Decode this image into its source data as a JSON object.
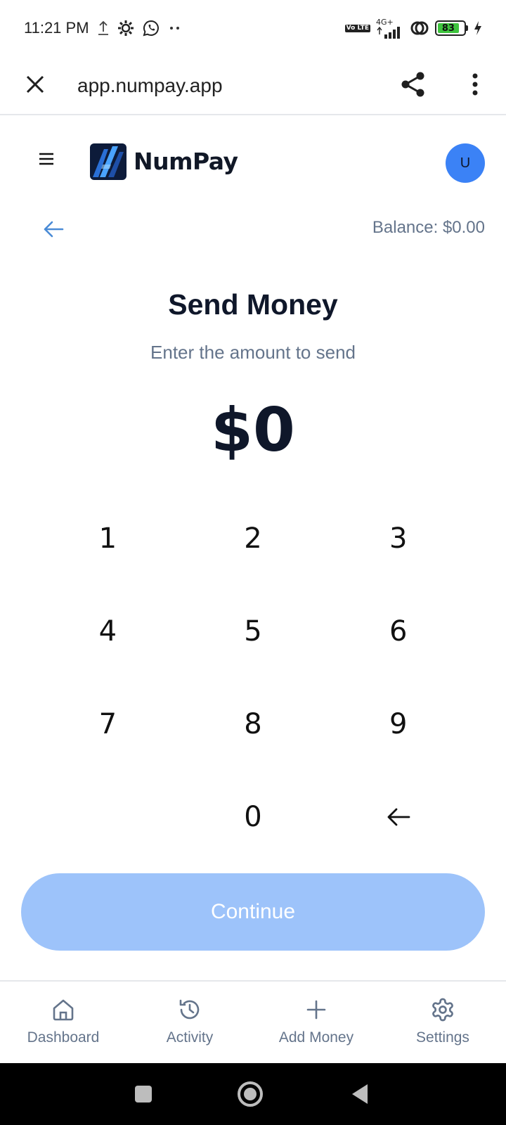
{
  "status_bar": {
    "time": "11:21 PM",
    "left_icons": [
      "upload-icon",
      "gear-icon",
      "whatsapp-icon",
      "more-dots-icon"
    ],
    "network": "4G+",
    "volte": "Vo LTE",
    "battery_level": "83",
    "right_icons": [
      "volte-icon",
      "signal-icon",
      "hotspot-icon",
      "battery-icon",
      "charging-icon"
    ]
  },
  "browser": {
    "url": "app.numpay.app",
    "icons": [
      "close-icon",
      "share-icon",
      "more-vertical-icon"
    ]
  },
  "header": {
    "brand": "NumPay",
    "avatar_initial": "U",
    "icons": [
      "menu-icon",
      "logo-icon"
    ]
  },
  "subheader": {
    "balance": "Balance: $0.00"
  },
  "main": {
    "title": "Send Money",
    "subtitle": "Enter the amount to send",
    "amount": "$0"
  },
  "keypad": {
    "keys": [
      "1",
      "2",
      "3",
      "4",
      "5",
      "6",
      "7",
      "8",
      "9",
      "",
      "0",
      "←"
    ]
  },
  "continue_label": "Continue",
  "bottom_nav": {
    "items": [
      {
        "label": "Dashboard",
        "icon": "home-icon"
      },
      {
        "label": "Activity",
        "icon": "history-icon"
      },
      {
        "label": "Add Money",
        "icon": "plus-icon"
      },
      {
        "label": "Settings",
        "icon": "settings-icon"
      }
    ]
  },
  "colors": {
    "accent": "#3b82f6",
    "continue_disabled": "#9dc3fa",
    "muted_text": "#64748b",
    "primary_text": "#0f172a"
  }
}
